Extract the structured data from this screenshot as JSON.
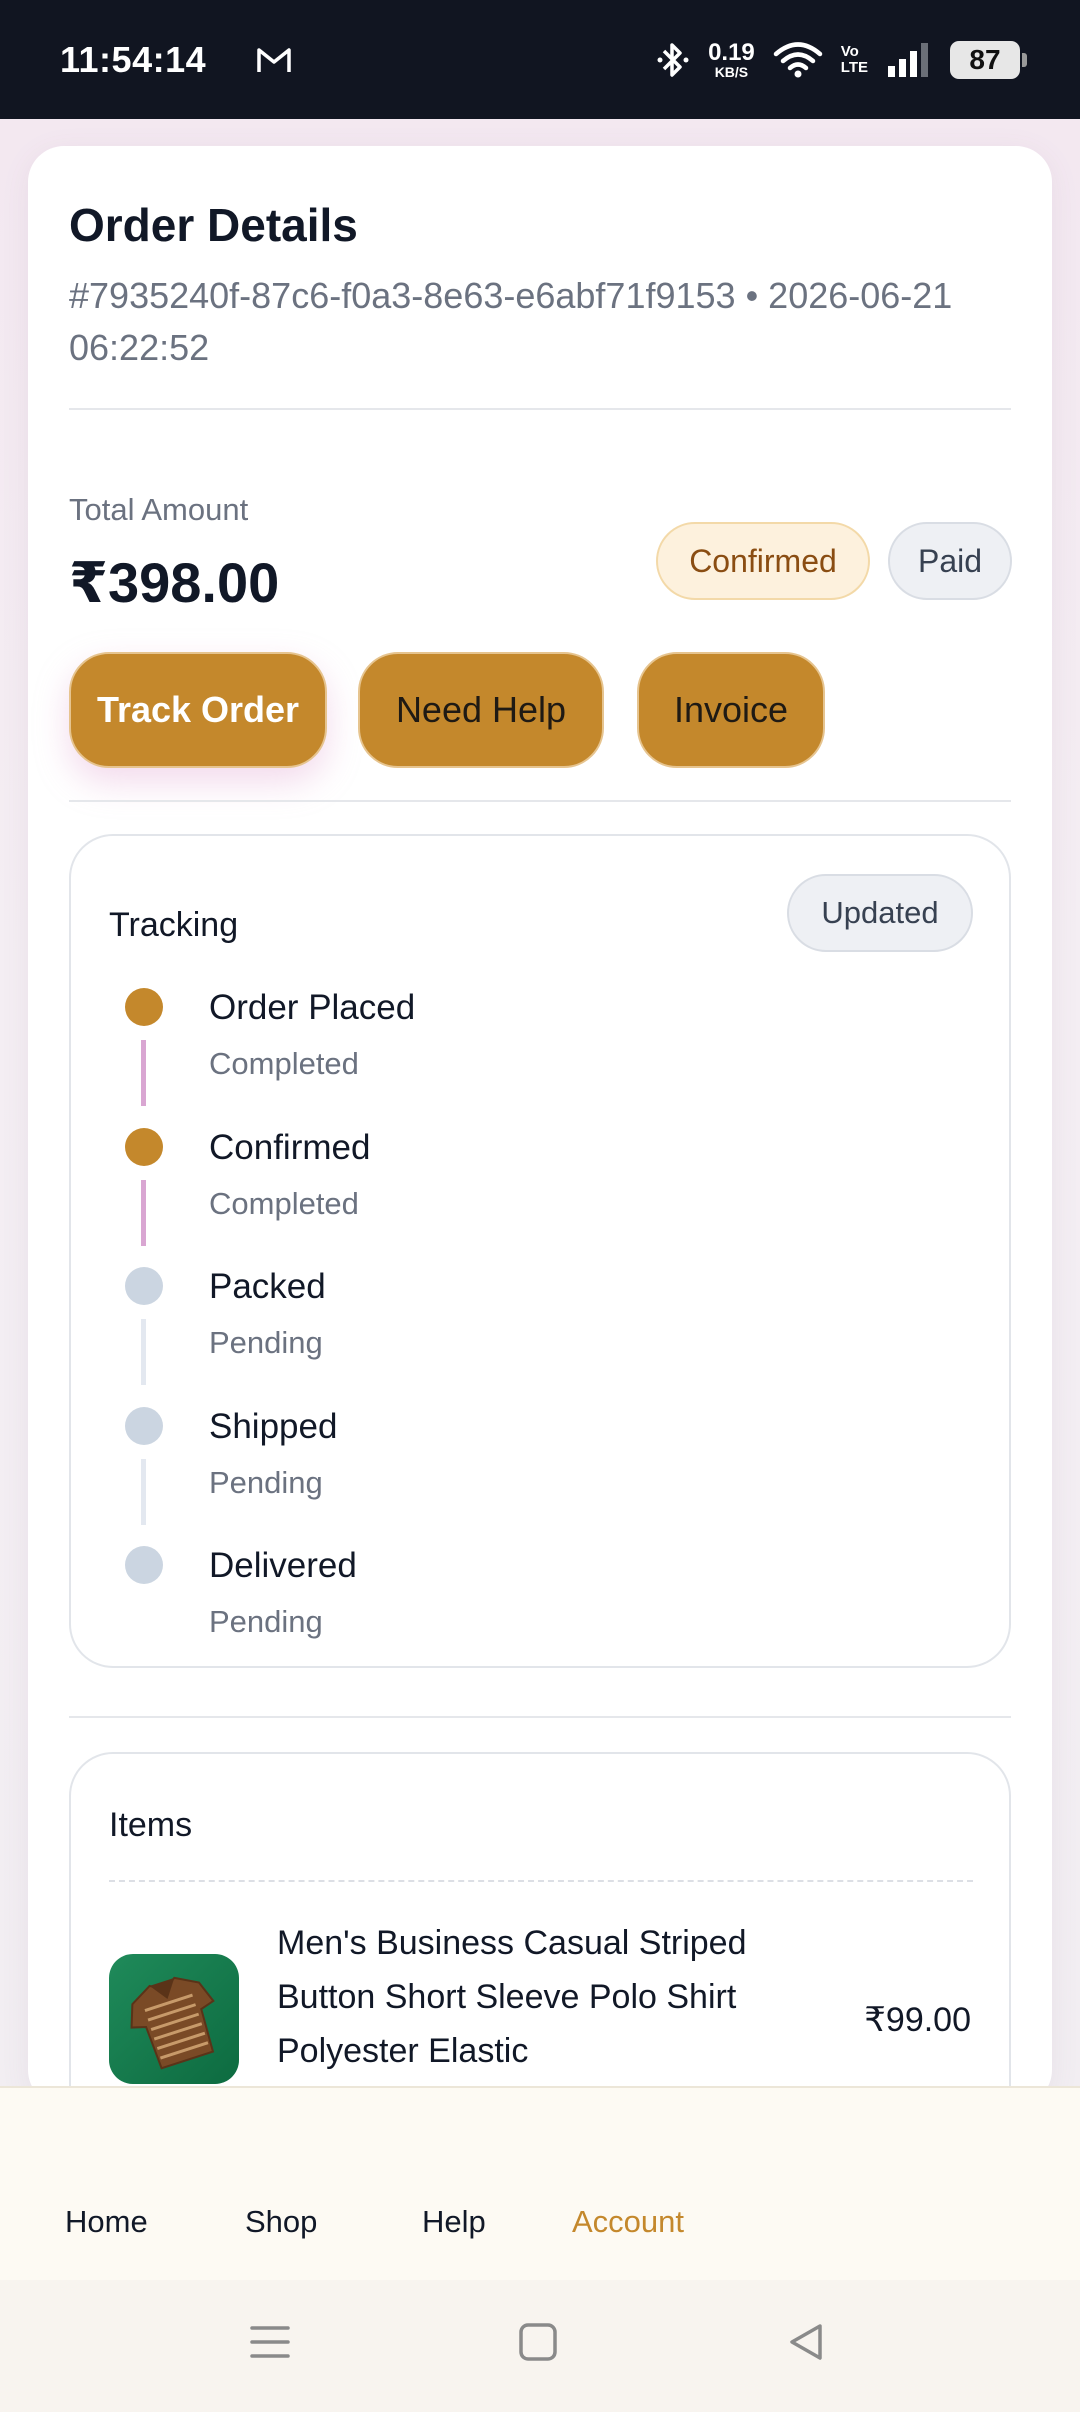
{
  "status_bar": {
    "time": "11:54:14",
    "speed_value": "0.19",
    "speed_unit": "KB/S",
    "volte_top": "Vo",
    "volte_bottom": "LTE",
    "battery": "87"
  },
  "order": {
    "title": "Order Details",
    "meta": "#7935240f-87c6-f0a3-8e63-e6abf71f9153 • 2026-06-21 06:22:52",
    "total_label": "Total Amount",
    "total_value": "₹398.00",
    "status_badge": "Confirmed",
    "payment_badge": "Paid"
  },
  "actions": {
    "track": "Track Order",
    "help": "Need Help",
    "invoice": "Invoice"
  },
  "tracking": {
    "title": "Tracking",
    "badge": "Updated",
    "steps": [
      {
        "name": "Order Placed",
        "status": "Completed"
      },
      {
        "name": "Confirmed",
        "status": "Completed"
      },
      {
        "name": "Packed",
        "status": "Pending"
      },
      {
        "name": "Shipped",
        "status": "Pending"
      },
      {
        "name": "Delivered",
        "status": "Pending"
      }
    ]
  },
  "items": {
    "title": "Items",
    "list": [
      {
        "name": "Men's Business Casual Striped Button Short Sleeve Polo Shirt Polyester Elastic",
        "price": "₹99.00"
      }
    ]
  },
  "bottom_nav": {
    "home": "Home",
    "shop": "Shop",
    "help": "Help",
    "account": "Account",
    "active": "Account"
  },
  "colors": {
    "accent": "#c4882c",
    "done_dot": "#c4882c",
    "pending_dot": "#cbd5e1",
    "status_bar_bg": "#111521"
  }
}
